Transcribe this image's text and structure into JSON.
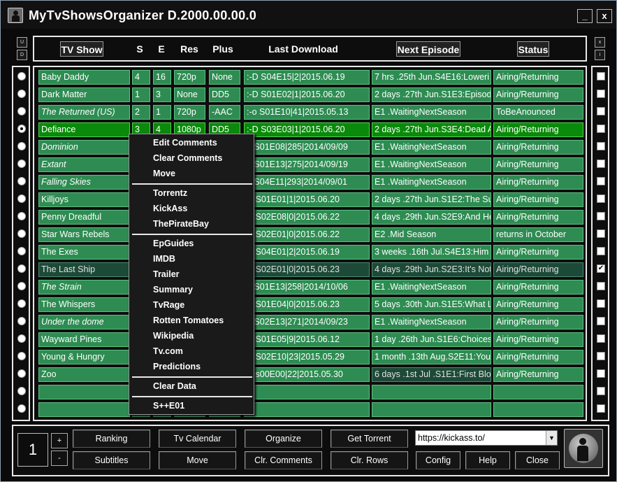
{
  "window": {
    "title": "MyTvShowsOrganizer D.2000.00.00.0",
    "minimize_label": "_",
    "close_label": "x"
  },
  "side_controls": {
    "left_top": "U",
    "left_bottom": "D",
    "right_top": "x",
    "right_bottom": "i"
  },
  "headers": {
    "tv_show": "TV Show",
    "season": "S",
    "episode": "E",
    "resolution": "Res",
    "plus": "Plus",
    "last_download": "Last Download",
    "next_episode": "Next Episode",
    "status": "Status"
  },
  "rows": [
    {
      "show": "Baby Daddy",
      "s": "4",
      "e": "16",
      "res": "720p",
      "plus": "None",
      "last": ":-D S04E15|2|2015.06.19",
      "next": "7 hrs .25th Jun.S4E16:Loweri",
      "status": "Airing/Returning",
      "italic": false,
      "radio": false,
      "checked": false,
      "state": ""
    },
    {
      "show": "Dark Matter",
      "s": "1",
      "e": "3",
      "res": "None",
      "plus": "DD5",
      "last": ":-D S01E02|1|2015.06.20",
      "next": "2 days .27th Jun.S1E3:Episod",
      "status": "Airing/Returning",
      "italic": false,
      "radio": false,
      "checked": false,
      "state": ""
    },
    {
      "show": "The Returned (US)",
      "s": "2",
      "e": "1",
      "res": "720p",
      "plus": "-AAC",
      "last": ":-o S01E10|41|2015.05.13",
      "next": "E1 .WaitingNextSeason",
      "status": "ToBeAnounced",
      "italic": true,
      "radio": false,
      "checked": false,
      "state": ""
    },
    {
      "show": "Defiance",
      "s": "3",
      "e": "4",
      "res": "1080p",
      "plus": "DD5",
      "last": ":-D S03E03|1|2015.06.20",
      "next": "2 days .27th Jun.S3E4:Dead A",
      "status": "Airing/Returning",
      "italic": false,
      "radio": true,
      "checked": false,
      "state": "sel"
    },
    {
      "show": "Dominion",
      "s": "",
      "e": "",
      "res": "",
      "plus": "",
      "last": "o S01E08|285|2014/09/09",
      "next": "E1 .WaitingNextSeason",
      "status": "Airing/Returning",
      "italic": true,
      "radio": false,
      "checked": false,
      "state": ""
    },
    {
      "show": "Extant",
      "s": "",
      "e": "",
      "res": "",
      "plus": "",
      "last": "o S01E13|275|2014/09/19",
      "next": "E1 .WaitingNextSeason",
      "status": "Airing/Returning",
      "italic": true,
      "radio": false,
      "checked": false,
      "state": ""
    },
    {
      "show": "Falling Skies",
      "s": "",
      "e": "",
      "res": "",
      "plus": "",
      "last": "o S04E11|293|2014/09/01",
      "next": "E1 .WaitingNextSeason",
      "status": "Airing/Returning",
      "italic": true,
      "radio": false,
      "checked": false,
      "state": ""
    },
    {
      "show": "Killjoys",
      "s": "",
      "e": "",
      "res": "",
      "plus": "",
      "last": "D S01E01|1|2015.06.20",
      "next": "2 days .27th Jun.S1E2:The Su",
      "status": "Airing/Returning",
      "italic": false,
      "radio": false,
      "checked": false,
      "state": ""
    },
    {
      "show": "Penny Dreadful",
      "s": "",
      "e": "",
      "res": "",
      "plus": "",
      "last": "D S02E08|0|2015.06.22",
      "next": "4 days .29th Jun.S2E9:And He",
      "status": "Airing/Returning",
      "italic": false,
      "radio": false,
      "checked": false,
      "state": ""
    },
    {
      "show": "Star Wars Rebels",
      "s": "",
      "e": "",
      "res": "",
      "plus": "",
      "last": "D S02E01|0|2015.06.22",
      "next": "E2 .Mid Season",
      "status": "returns in October",
      "italic": false,
      "radio": false,
      "checked": false,
      "state": ""
    },
    {
      "show": "The Exes",
      "s": "",
      "e": "",
      "res": "",
      "plus": "",
      "last": "D S04E01|2|2015.06.19",
      "next": "3 weeks .16th Jul.S4E13:Him",
      "status": "Airing/Returning",
      "italic": false,
      "radio": false,
      "checked": false,
      "state": ""
    },
    {
      "show": "The Last Ship",
      "s": "",
      "e": "",
      "res": "",
      "plus": "",
      "last": "D S02E01|0|2015.06.23",
      "next": "4 days .29th Jun.S2E3:It's Not",
      "status": "Airing/Returning",
      "italic": false,
      "radio": false,
      "checked": true,
      "state": "dark"
    },
    {
      "show": "The Strain",
      "s": "",
      "e": "",
      "res": "",
      "plus": "",
      "last": "o S01E13|258|2014/10/06",
      "next": "E1 .WaitingNextSeason",
      "status": "Airing/Returning",
      "italic": true,
      "radio": false,
      "checked": false,
      "state": ""
    },
    {
      "show": "The Whispers",
      "s": "",
      "e": "",
      "res": "",
      "plus": "",
      "last": "D S01E04|0|2015.06.23",
      "next": "5 days .30th Jun.S1E5:What L",
      "status": "Airing/Returning",
      "italic": false,
      "radio": false,
      "checked": false,
      "state": ""
    },
    {
      "show": "Under the dome",
      "s": "",
      "e": "",
      "res": "",
      "plus": "",
      "last": "o S02E13|271|2014/09/23",
      "next": "E1 .WaitingNextSeason",
      "status": "Airing/Returning",
      "italic": true,
      "radio": false,
      "checked": false,
      "state": ""
    },
    {
      "show": "Wayward Pines",
      "s": "",
      "e": "",
      "res": "",
      "plus": "",
      "last": "D S01E05|9|2015.06.12",
      "next": "1 day .26th Jun.S1E6:Choices",
      "status": "Airing/Returning",
      "italic": false,
      "radio": false,
      "checked": false,
      "state": ""
    },
    {
      "show": "Young & Hungry",
      "s": "",
      "e": "",
      "res": "",
      "plus": "",
      "last": "D S02E10|23|2015.05.29",
      "next": "1 month .13th Aug.S2E11:Your",
      "status": "Airing/Returning",
      "italic": false,
      "radio": false,
      "checked": false,
      "state": ""
    },
    {
      "show": "Zoo",
      "s": "",
      "e": "",
      "res": "",
      "plus": "",
      "last": "D s00E00|22|2015.05.30",
      "next": "6 days .1st Jul .S1E1:First Bloo",
      "status": "Airing/Returning",
      "italic": false,
      "radio": false,
      "checked": false,
      "state": "dim"
    },
    {
      "show": "",
      "s": "",
      "e": "",
      "res": "",
      "plus": "",
      "last": "",
      "next": "",
      "status": "",
      "italic": false,
      "radio": false,
      "checked": false,
      "state": ""
    },
    {
      "show": "",
      "s": "",
      "e": "",
      "res": "",
      "plus": "",
      "last": "",
      "next": "",
      "status": "",
      "italic": false,
      "radio": false,
      "checked": false,
      "state": ""
    }
  ],
  "context_menu": {
    "groups": [
      [
        "Edit Comments",
        "Clear Comments",
        "Move"
      ],
      [
        "Torrentz",
        "KickAss",
        "ThePirateBay"
      ],
      [
        "EpGuides",
        "IMDB",
        "Trailer",
        "Summary",
        "TvRage",
        "Rotten Tomatoes",
        "Wikipedia",
        "Tv.com",
        "Predictions"
      ],
      [
        "Clear Data"
      ],
      [
        "S++E01"
      ]
    ]
  },
  "bottom": {
    "page_number": "1",
    "plus": "+",
    "minus": "-",
    "ranking": "Ranking",
    "tv_calendar": "Tv Calendar",
    "organize": "Organize",
    "get_torrent": "Get Torrent",
    "subtitles": "Subtitles",
    "move": "Move",
    "clr_comments": "Clr. Comments",
    "clr_rows": "Clr. Rows",
    "config": "Config",
    "help": "Help",
    "close": "Close",
    "url_value": "https://kickass.to/"
  },
  "colors": {
    "cell_green": "#2e8c52",
    "selected_green": "#0a8a0a",
    "dark_row": "#1d4a38"
  }
}
